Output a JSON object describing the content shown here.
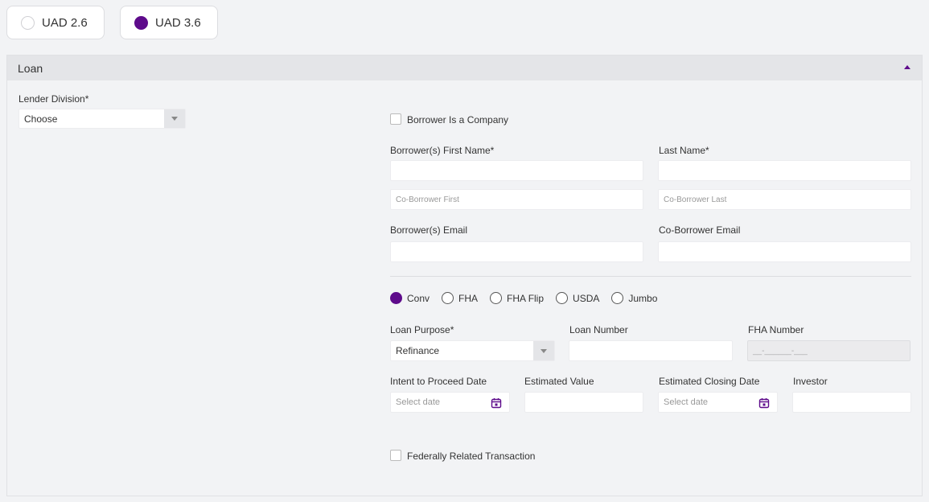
{
  "uad": {
    "options": [
      {
        "label": "UAD 2.6",
        "selected": false
      },
      {
        "label": "UAD 3.6",
        "selected": true
      }
    ]
  },
  "section": {
    "title": "Loan"
  },
  "lender": {
    "label": "Lender Division*",
    "value": "Choose"
  },
  "borrower_company": {
    "label": "Borrower Is a Company"
  },
  "borrower_first": {
    "label": "Borrower(s) First Name*",
    "value": ""
  },
  "borrower_last": {
    "label": "Last Name*",
    "value": ""
  },
  "coborrower_first": {
    "placeholder": "Co-Borrower First"
  },
  "coborrower_last": {
    "placeholder": "Co-Borrower Last"
  },
  "borrower_email": {
    "label": "Borrower(s) Email",
    "value": ""
  },
  "coborrower_email": {
    "label": "Co-Borrower Email",
    "value": ""
  },
  "loan_types": [
    {
      "label": "Conv",
      "checked": true
    },
    {
      "label": "FHA",
      "checked": false
    },
    {
      "label": "FHA Flip",
      "checked": false
    },
    {
      "label": "USDA",
      "checked": false
    },
    {
      "label": "Jumbo",
      "checked": false
    }
  ],
  "loan_purpose": {
    "label": "Loan Purpose*",
    "value": "Refinance"
  },
  "loan_number": {
    "label": "Loan Number",
    "value": ""
  },
  "fha_number": {
    "label": "FHA Number",
    "placeholder": "__-______-___"
  },
  "intent_date": {
    "label": "Intent to Proceed Date",
    "placeholder": "Select date"
  },
  "estimated_value": {
    "label": "Estimated Value",
    "value": ""
  },
  "closing_date": {
    "label": "Estimated Closing Date",
    "placeholder": "Select date"
  },
  "investor": {
    "label": "Investor",
    "value": ""
  },
  "federally_related": {
    "label": "Federally Related Transaction"
  },
  "colors": {
    "accent": "#5e0b8b",
    "background": "#f2f3f5"
  }
}
